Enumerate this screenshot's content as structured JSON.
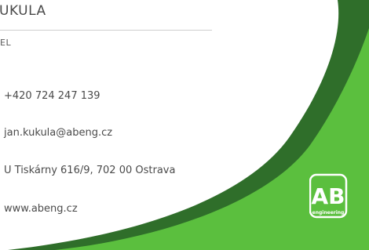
{
  "card": {
    "name_fragment": "UKULA",
    "role_fragment": "EL",
    "phone": "+420 724 247 139",
    "email": "jan.kukula@abeng.cz",
    "address": "U Tiskárny 616/9, 702 00 Ostrava",
    "website": "www.abeng.cz"
  },
  "logo": {
    "letters": "AB",
    "tagline": "engineering"
  },
  "colors": {
    "dark_green": "#2f6e2a",
    "light_green": "#5bbf3e",
    "text_gray": "#4a4a4a"
  }
}
